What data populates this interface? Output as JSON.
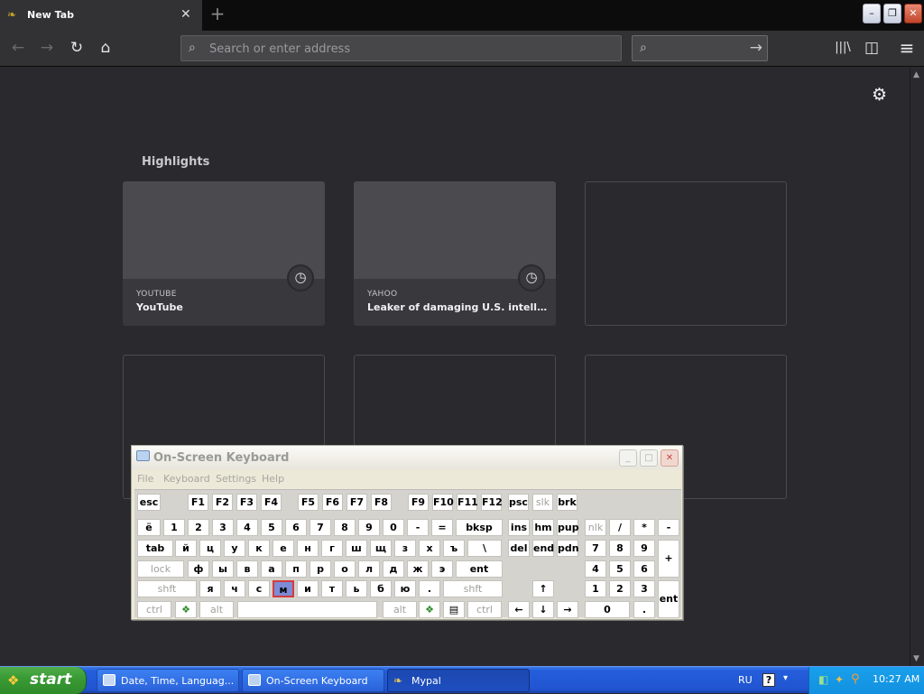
{
  "browser": {
    "tab_title": "New Tab",
    "tab_close": "✕",
    "new_tab": "+",
    "window_controls": [
      "–",
      "❐",
      "✕"
    ],
    "nav": {
      "back": "←",
      "forward": "→",
      "reload": "↻",
      "home": "⌂"
    },
    "url_placeholder": "Search or enter address",
    "search_go": "→",
    "toolbar": {
      "library": "|||\\",
      "sidebar": "◫",
      "menu": "≡"
    }
  },
  "newtab": {
    "settings_icon": "⚙",
    "highlights_heading": "Highlights",
    "cards": [
      {
        "source": "YOUTUBE",
        "title": "YouTube",
        "clock": "◷"
      },
      {
        "source": "YAHOO",
        "title": "Leaker of damaging U.S. intellig...",
        "clock": "◷"
      }
    ]
  },
  "osk": {
    "title": "On-Screen Keyboard",
    "menu": [
      "File",
      "Keyboard",
      "Settings",
      "Help"
    ],
    "window_controls": [
      "_",
      "□",
      "✕"
    ],
    "keys": {
      "row0": [
        "esc",
        "F1",
        "F2",
        "F3",
        "F4",
        "F5",
        "F6",
        "F7",
        "F8",
        "F9",
        "F10",
        "F11",
        "F12",
        "psc",
        "slk",
        "brk"
      ],
      "row1": [
        "ё",
        "1",
        "2",
        "3",
        "4",
        "5",
        "6",
        "7",
        "8",
        "9",
        "0",
        "-",
        "=",
        "bksp",
        "ins",
        "hm",
        "pup",
        "nlk",
        "/",
        "*",
        "-"
      ],
      "row2": [
        "tab",
        "й",
        "ц",
        "у",
        "к",
        "е",
        "н",
        "г",
        "ш",
        "щ",
        "з",
        "х",
        "ъ",
        "\\",
        "del",
        "end",
        "pdn",
        "7",
        "8",
        "9",
        "+"
      ],
      "row3": [
        "lock",
        "ф",
        "ы",
        "в",
        "а",
        "п",
        "р",
        "о",
        "л",
        "д",
        "ж",
        "э",
        "ent",
        "4",
        "5",
        "6"
      ],
      "row4": [
        "shft",
        "я",
        "ч",
        "с",
        "м",
        "и",
        "т",
        "ь",
        "б",
        "ю",
        ".",
        "shft",
        "↑",
        "1",
        "2",
        "3",
        "ent"
      ],
      "row5": [
        "ctrl",
        "alt",
        "alt",
        "ctrl",
        "←",
        "↓",
        "→",
        "0",
        "."
      ]
    },
    "highlighted_key": "м"
  },
  "taskbar": {
    "start_label": "start",
    "buttons": [
      "Date, Time, Languag...",
      "On-Screen Keyboard",
      "Mypal"
    ],
    "language": "RU",
    "help_icon": "?",
    "clock": "10:27 AM"
  }
}
